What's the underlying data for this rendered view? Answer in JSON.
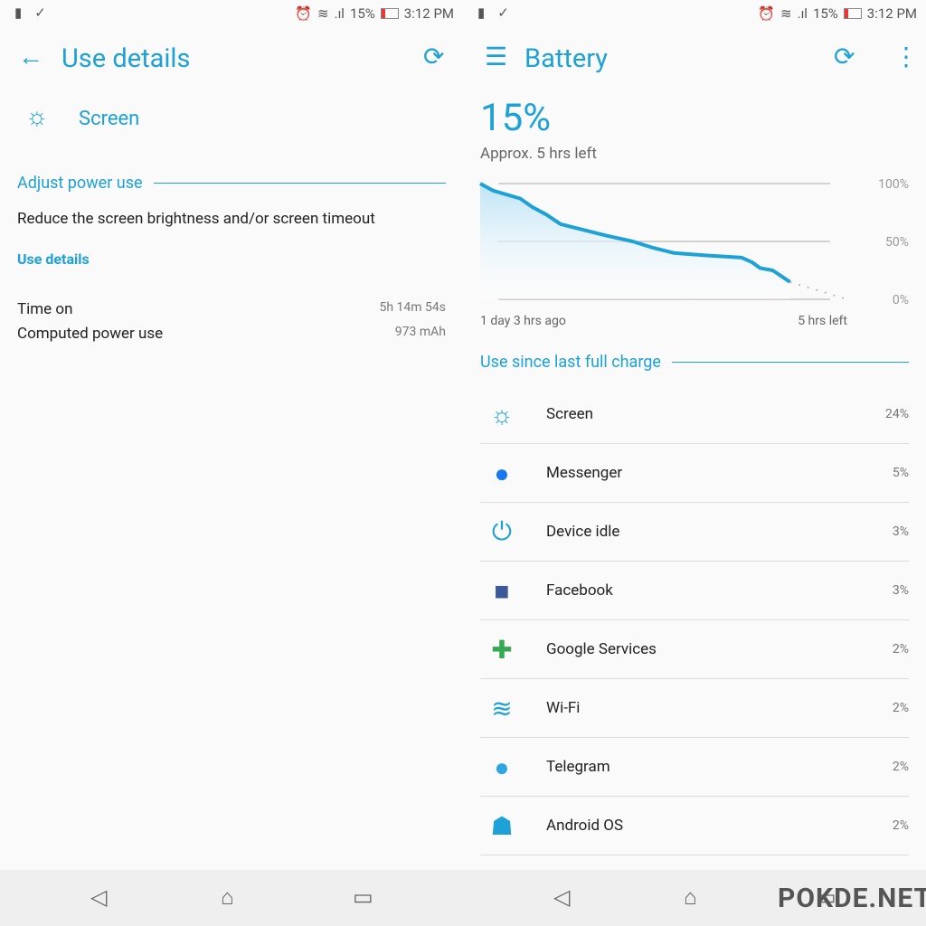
{
  "status": {
    "percent": "15%",
    "time": "3:12 PM"
  },
  "left": {
    "title": "Use details",
    "item": "Screen",
    "section": "Adjust power use",
    "advice": "Reduce the screen brightness and/or screen timeout",
    "link": "Use details",
    "rows": [
      {
        "label": "Time on",
        "value": "5h 14m 54s"
      },
      {
        "label": "Computed power use",
        "value": "973 mAh"
      }
    ]
  },
  "right": {
    "title": "Battery",
    "percent": "15%",
    "remaining": "Approx. 5 hrs left",
    "section": "Use since last full charge",
    "items": [
      {
        "name": "Screen",
        "pct": "24%",
        "icon": "brightness-icon"
      },
      {
        "name": "Messenger",
        "pct": "5%",
        "icon": "messenger-icon"
      },
      {
        "name": "Device idle",
        "pct": "3%",
        "icon": "power-icon"
      },
      {
        "name": "Facebook",
        "pct": "3%",
        "icon": "facebook-icon"
      },
      {
        "name": "Google Services",
        "pct": "2%",
        "icon": "google-services-icon"
      },
      {
        "name": "Wi-Fi",
        "pct": "2%",
        "icon": "wifi-icon"
      },
      {
        "name": "Telegram",
        "pct": "2%",
        "icon": "telegram-icon"
      },
      {
        "name": "Android OS",
        "pct": "2%",
        "icon": "android-icon"
      }
    ]
  },
  "chart_data": {
    "type": "line",
    "xlabel_start": "1 day 3 hrs ago",
    "xlabel_end": "5 hrs left",
    "yticks": [
      "100%",
      "50%",
      "0%"
    ],
    "ylim": [
      0,
      100
    ],
    "xlim": [
      -27,
      5
    ],
    "x": [
      -27,
      -25.9,
      -23.5,
      -22.5,
      -21.2,
      -20,
      -18.4,
      -16,
      -13.7,
      -12.1,
      -10.1,
      -7.4,
      -4.2,
      -3.3,
      -2.6,
      -1.5,
      0
    ],
    "values": [
      100,
      94,
      87,
      80,
      73,
      65,
      61,
      55,
      50,
      45,
      40,
      38,
      36,
      32,
      27,
      25,
      15
    ],
    "projection": {
      "x": [
        0,
        5
      ],
      "values": [
        15,
        0
      ]
    },
    "color": "#1ea1d6"
  },
  "watermark": "POKDE.NET"
}
